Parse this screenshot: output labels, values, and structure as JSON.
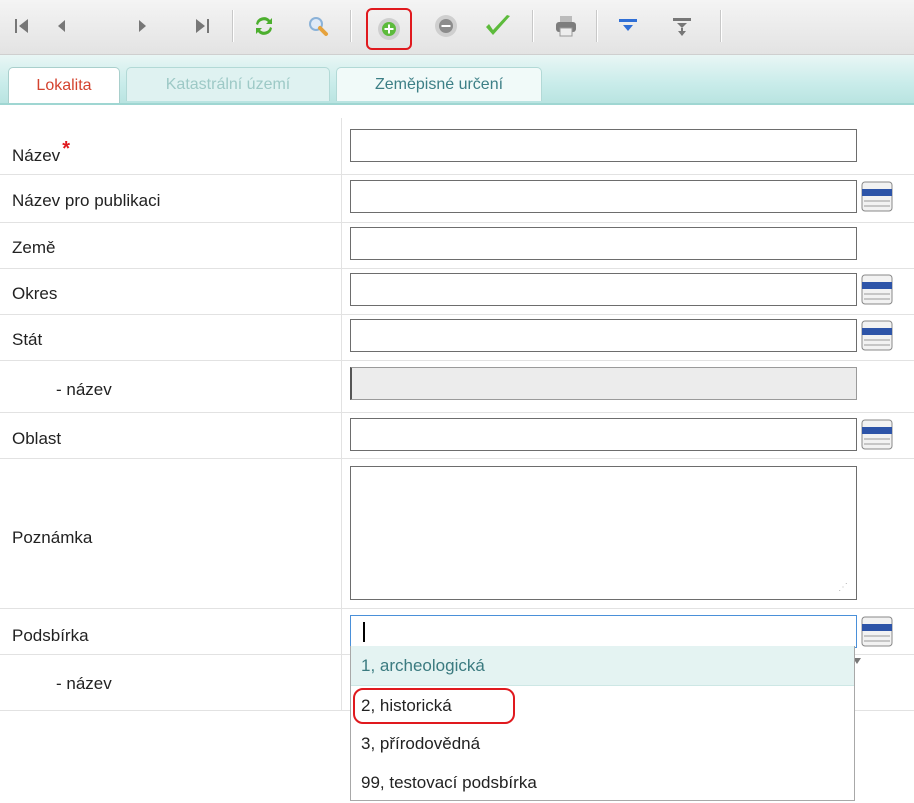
{
  "toolbar": {
    "buttons": [
      {
        "name": "first-record-button",
        "icon": "first-icon"
      },
      {
        "name": "previous-record-button",
        "icon": "previous-icon"
      },
      {
        "name": "next-record-button",
        "icon": "next-icon"
      },
      {
        "name": "last-record-button",
        "icon": "last-icon"
      },
      {
        "name": "refresh-button",
        "icon": "refresh-icon"
      },
      {
        "name": "search-button",
        "icon": "search-icon"
      },
      {
        "name": "add-record-button",
        "icon": "add-icon"
      },
      {
        "name": "delete-record-button",
        "icon": "remove-icon"
      },
      {
        "name": "confirm-button",
        "icon": "checkmark-icon"
      },
      {
        "name": "print-button",
        "icon": "printer-icon"
      },
      {
        "name": "filter-button",
        "icon": "filter-icon"
      },
      {
        "name": "clear-filter-button",
        "icon": "clear-filter-icon"
      }
    ]
  },
  "tabs": [
    {
      "label": "Lokalita",
      "state": "active"
    },
    {
      "label": "Katastrální území",
      "state": "disabled"
    },
    {
      "label": "Zeměpisné určení",
      "state": "normal"
    }
  ],
  "form": {
    "nazev": {
      "label": "Název",
      "required_mark": "*",
      "value": ""
    },
    "nazev_publikace": {
      "label": "Název pro publikaci",
      "value": ""
    },
    "zeme": {
      "label": "Země",
      "value": ""
    },
    "okres": {
      "label": "Okres",
      "value": ""
    },
    "stat": {
      "label": "Stát",
      "value": ""
    },
    "stat_nazev": {
      "label": "- název",
      "value": ""
    },
    "oblast": {
      "label": "Oblast",
      "value": ""
    },
    "poznamka": {
      "label": "Poznámka",
      "value": ""
    },
    "podsbirka": {
      "label": "Podsbírka",
      "value": ""
    },
    "podsbirka_nazev": {
      "label": "- název"
    }
  },
  "dropdown": {
    "options": [
      "1, archeologická",
      "2, historická",
      "3, přírodovědná",
      "99, testovací podsbírka"
    ],
    "hovered_index": 0,
    "highlighted_index": 1
  },
  "colors": {
    "tab_active_text": "#d4432f",
    "tab_bar": "#c9ecea",
    "highlight_red": "#e0191e",
    "dropdown_hover": "#e4f3f2"
  }
}
